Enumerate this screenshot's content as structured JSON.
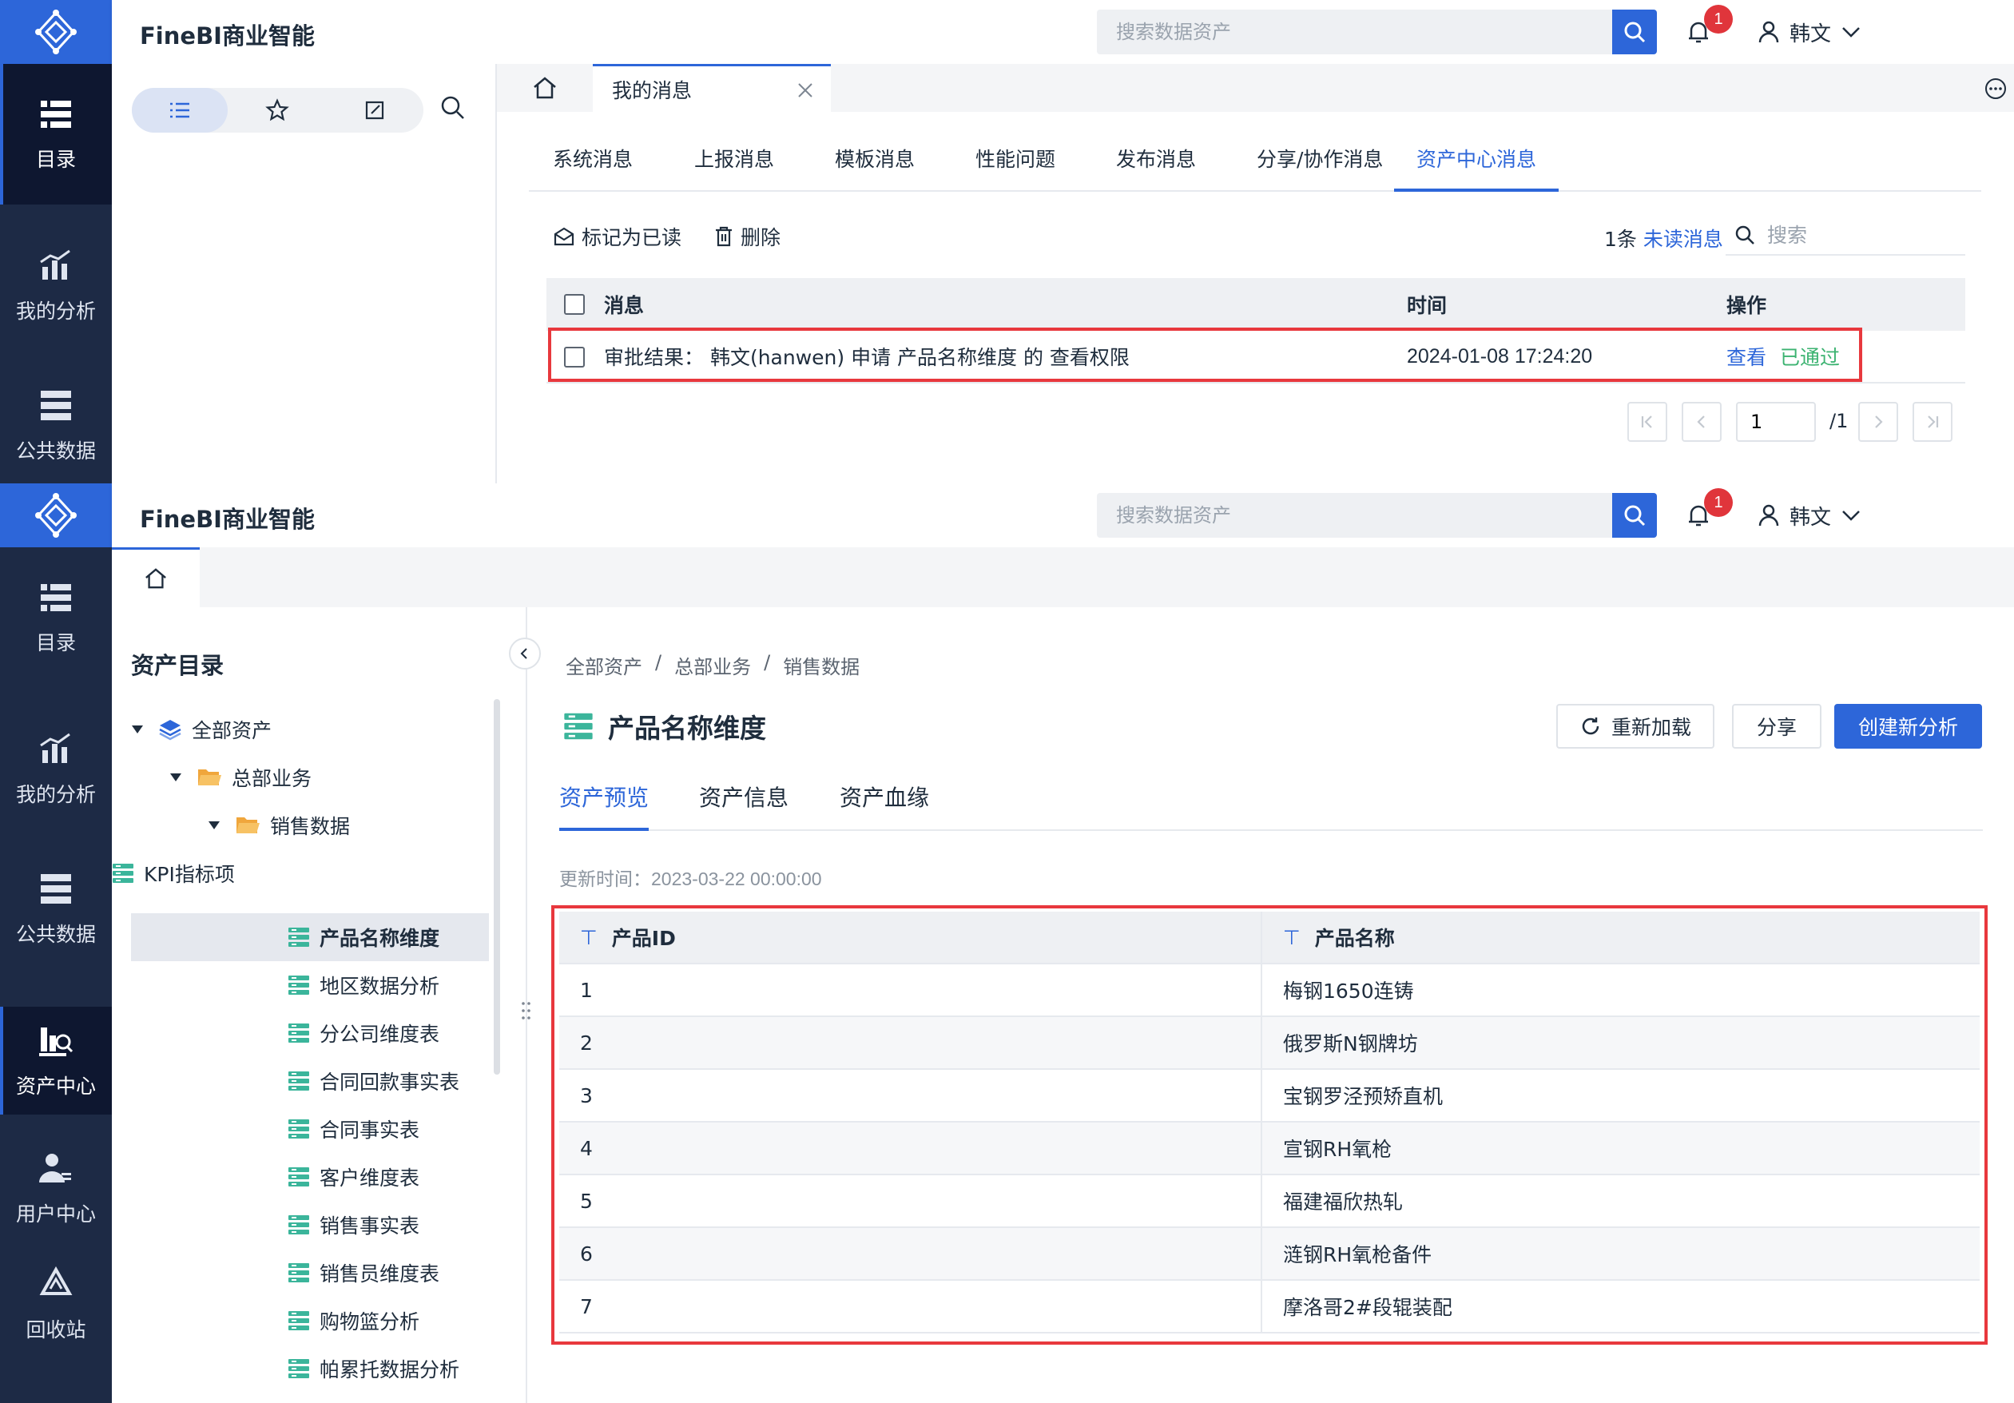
{
  "brand": "FineBI商业智能",
  "search_placeholder": "搜索数据资产",
  "notification_count": "1",
  "user_name": "韩文",
  "nav": {
    "catalog": "目录",
    "my_analysis": "我的分析",
    "public_data": "公共数据",
    "asset_center": "资产中心",
    "user_center": "用户中心",
    "recycle_bin": "回收站"
  },
  "messages_page": {
    "tab_label": "我的消息",
    "tabs": [
      "系统消息",
      "上报消息",
      "模板消息",
      "性能问题",
      "发布消息",
      "分享/协作消息",
      "资产中心消息"
    ],
    "active_tab": "资产中心消息",
    "mark_read": "标记为已读",
    "delete": "删除",
    "unread_count": "1条",
    "unread_label": "未读消息",
    "search_placeholder": "搜索",
    "columns": [
      "消息",
      "时间",
      "操作"
    ],
    "rows": [
      {
        "message": "审批结果：  韩文(hanwen) 申请 产品名称维度 的 查看权限",
        "time": "2024-01-08 17:24:20",
        "view": "查看",
        "status": "已通过"
      }
    ],
    "pager": {
      "current": "1",
      "total": "/1"
    }
  },
  "asset_page": {
    "tree_title": "资产目录",
    "tree": [
      {
        "label": "全部资产",
        "level": 0,
        "type": "root"
      },
      {
        "label": "总部业务",
        "level": 1,
        "type": "folder"
      },
      {
        "label": "销售数据",
        "level": 2,
        "type": "folder"
      },
      {
        "label": "KPI指标项",
        "level": 3,
        "type": "table"
      },
      {
        "label": "产品名称维度",
        "level": 3,
        "type": "table",
        "selected": true
      },
      {
        "label": "地区数据分析",
        "level": 3,
        "type": "table"
      },
      {
        "label": "分公司维度表",
        "level": 3,
        "type": "table"
      },
      {
        "label": "合同回款事实表",
        "level": 3,
        "type": "table"
      },
      {
        "label": "合同事实表",
        "level": 3,
        "type": "table"
      },
      {
        "label": "客户维度表",
        "level": 3,
        "type": "table"
      },
      {
        "label": "销售事实表",
        "level": 3,
        "type": "table"
      },
      {
        "label": "销售员维度表",
        "level": 3,
        "type": "table"
      },
      {
        "label": "购物篮分析",
        "level": 3,
        "type": "table"
      },
      {
        "label": "帕累托数据分析",
        "level": 3,
        "type": "table"
      }
    ],
    "breadcrumb": [
      "全部资产",
      "总部业务",
      "销售数据"
    ],
    "title": "产品名称维度",
    "reload": "重新加载",
    "share": "分享",
    "create_analysis": "创建新分析",
    "tabs": [
      "资产预览",
      "资产信息",
      "资产血缘"
    ],
    "active_tab": "资产预览",
    "updated_label": "更新时间：",
    "updated_time": "2023-03-22 00:00:00",
    "table": {
      "columns": [
        "产品ID",
        "产品名称"
      ],
      "rows": [
        [
          "1",
          "梅钢1650连铸"
        ],
        [
          "2",
          "俄罗斯N钢牌坊"
        ],
        [
          "3",
          "宝钢罗泾预矫直机"
        ],
        [
          "4",
          "宣钢RH氧枪"
        ],
        [
          "5",
          "福建福欣热轧"
        ],
        [
          "6",
          "涟钢RH氧枪备件"
        ],
        [
          "7",
          "摩洛哥2#段辊装配"
        ]
      ]
    }
  },
  "colors": {
    "accent": "#2d66d9",
    "nav_bg": "#1d2a45",
    "success": "#3cb371",
    "highlight_box": "#e8383d",
    "badge": "#e0353b"
  }
}
